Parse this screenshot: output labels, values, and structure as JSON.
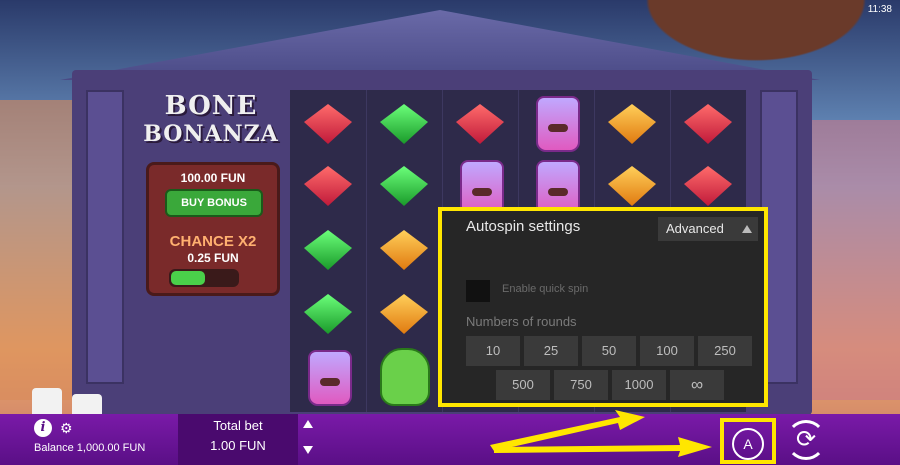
{
  "status_bar": {
    "time": "11:38"
  },
  "game": {
    "logo_line1": "BONE",
    "logo_line2": "BONANZA",
    "bonus_price": "100.00 FUN",
    "buy_bonus_label": "BUY BONUS",
    "chance_label": "CHANCE X2",
    "chance_price": "0.25 FUN"
  },
  "autospin": {
    "title": "Autospin settings",
    "advanced_label": "Advanced",
    "quick_spin_label": "Enable quick spin",
    "rounds_label": "Numbers of rounds",
    "rounds_row1": [
      "10",
      "25",
      "50",
      "100",
      "250"
    ],
    "rounds_row2": [
      "500",
      "750",
      "1000",
      "∞"
    ]
  },
  "bottom_bar": {
    "info_label": "i",
    "balance_label": "Balance 1,000.00 FUN",
    "total_bet_label": "Total bet",
    "total_bet_value": "1.00 FUN",
    "autospin_label": "A"
  },
  "colors": {
    "highlight": "#ffe600",
    "bar": "#6a1296"
  }
}
